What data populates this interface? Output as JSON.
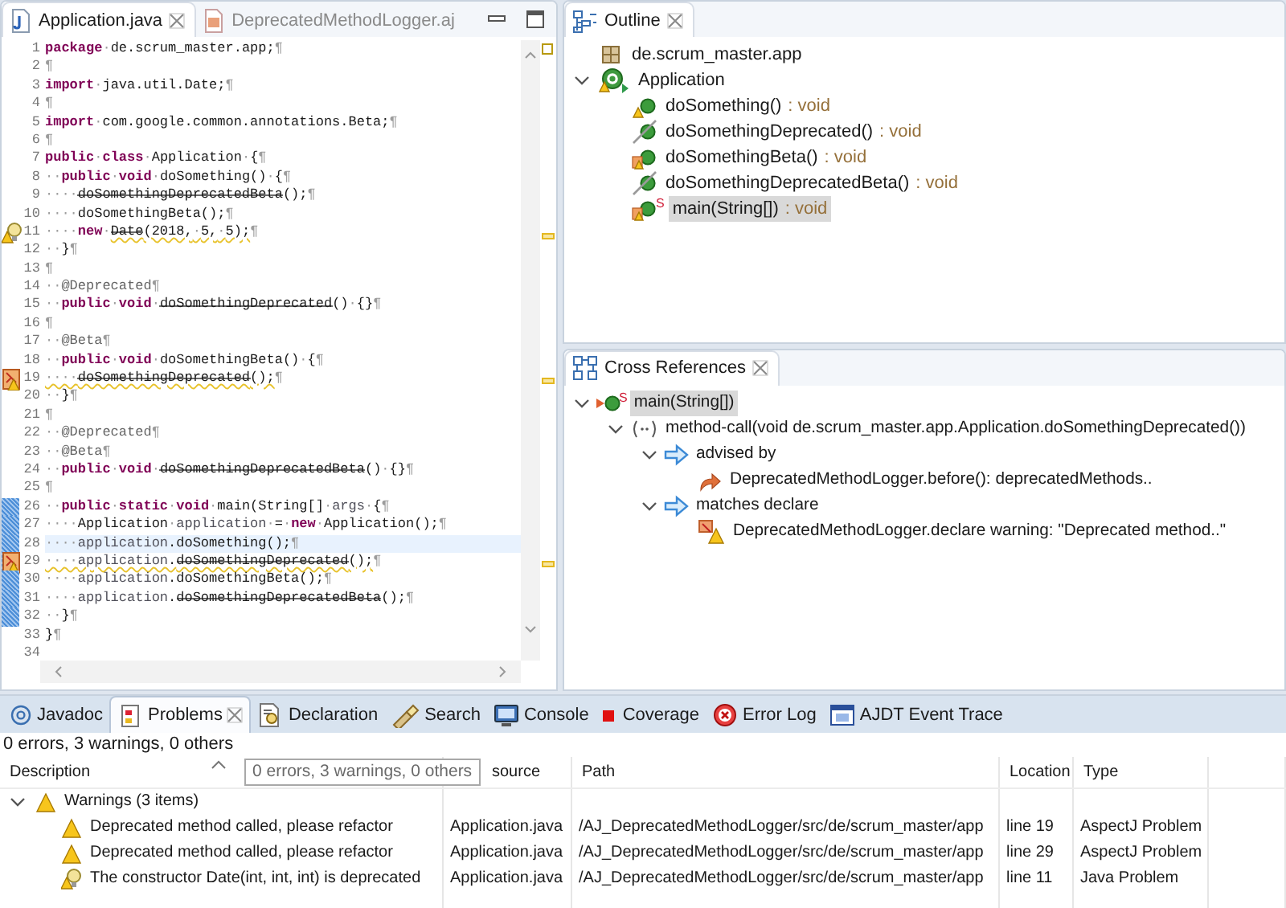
{
  "editor": {
    "tabs": [
      {
        "label": "Application.java",
        "kind": "java",
        "selected": true
      },
      {
        "label": "DeprecatedMethodLogger.aj",
        "kind": "aspect",
        "selected": false
      }
    ],
    "lines": [
      {
        "number": "1",
        "changed": false,
        "current": false,
        "tokens": [
          {
            "kind": "keyword",
            "text": "package"
          },
          {
            "kind": "plain",
            "text": "·de.scrum_master.app;¶"
          }
        ]
      },
      {
        "number": "2",
        "changed": false,
        "current": false,
        "tokens": [
          {
            "kind": "plain",
            "text": "¶"
          }
        ]
      },
      {
        "number": "3",
        "changed": false,
        "current": false,
        "tokens": [
          {
            "kind": "keyword",
            "text": "import"
          },
          {
            "kind": "plain",
            "text": "·java.util.Date;¶"
          }
        ]
      },
      {
        "number": "4",
        "changed": false,
        "current": false,
        "tokens": [
          {
            "kind": "plain",
            "text": "¶"
          }
        ]
      },
      {
        "number": "5",
        "changed": false,
        "current": false,
        "tokens": [
          {
            "kind": "keyword",
            "text": "import"
          },
          {
            "kind": "plain",
            "text": "·com.google.common.annotations.Beta;¶"
          }
        ]
      },
      {
        "number": "6",
        "changed": false,
        "current": false,
        "tokens": [
          {
            "kind": "plain",
            "text": "¶"
          }
        ]
      },
      {
        "number": "7",
        "changed": false,
        "current": false,
        "tokens": [
          {
            "kind": "keyword",
            "text": "public"
          },
          {
            "kind": "plain",
            "text": "·"
          },
          {
            "kind": "keyword",
            "text": "class"
          },
          {
            "kind": "plain",
            "text": "·Application·{¶"
          }
        ]
      },
      {
        "number": "8",
        "changed": false,
        "current": false,
        "tokens": [
          {
            "kind": "plain",
            "text": "··"
          },
          {
            "kind": "keyword",
            "text": "public"
          },
          {
            "kind": "plain",
            "text": "·"
          },
          {
            "kind": "keyword",
            "text": "void"
          },
          {
            "kind": "plain",
            "text": "·doSomething()·{¶"
          }
        ]
      },
      {
        "number": "9",
        "changed": false,
        "current": false,
        "tokens": [
          {
            "kind": "plain",
            "text": "····"
          },
          {
            "kind": "deprecated",
            "text": "doSomethingDeprecatedBeta"
          },
          {
            "kind": "plain",
            "text": "();¶"
          }
        ]
      },
      {
        "number": "10",
        "changed": false,
        "current": false,
        "tokens": [
          {
            "kind": "plain",
            "text": "····doSomethingBeta();¶"
          }
        ]
      },
      {
        "number": "11",
        "changed": false,
        "current": false,
        "kind": "lightbulb-warning",
        "tokens": [
          {
            "kind": "plain",
            "text": "····"
          },
          {
            "kind": "keyword",
            "text": "new"
          },
          {
            "kind": "plain",
            "text": "·"
          },
          {
            "kind": "deprecated-warn",
            "text": "Date"
          },
          {
            "kind": "plain-warn",
            "text": "(2018,·5,·5);"
          },
          {
            "kind": "plain",
            "text": "¶"
          }
        ]
      },
      {
        "number": "12",
        "changed": false,
        "current": false,
        "tokens": [
          {
            "kind": "plain",
            "text": "··}¶"
          }
        ]
      },
      {
        "number": "13",
        "changed": false,
        "current": false,
        "tokens": [
          {
            "kind": "plain",
            "text": "¶"
          }
        ]
      },
      {
        "number": "14",
        "changed": false,
        "current": false,
        "tokens": [
          {
            "kind": "plain",
            "text": "··"
          },
          {
            "kind": "annotation",
            "text": "@Deprecated"
          },
          {
            "kind": "plain",
            "text": "¶"
          }
        ]
      },
      {
        "number": "15",
        "changed": false,
        "current": false,
        "tokens": [
          {
            "kind": "plain",
            "text": "··"
          },
          {
            "kind": "keyword",
            "text": "public"
          },
          {
            "kind": "plain",
            "text": "·"
          },
          {
            "kind": "keyword",
            "text": "void"
          },
          {
            "kind": "plain",
            "text": "·"
          },
          {
            "kind": "deprecated",
            "text": "doSomethingDeprecated"
          },
          {
            "kind": "plain",
            "text": "()·{}¶"
          }
        ]
      },
      {
        "number": "16",
        "changed": false,
        "current": false,
        "tokens": [
          {
            "kind": "plain",
            "text": "¶"
          }
        ]
      },
      {
        "number": "17",
        "changed": false,
        "current": false,
        "tokens": [
          {
            "kind": "plain",
            "text": "··"
          },
          {
            "kind": "annotation",
            "text": "@Beta"
          },
          {
            "kind": "plain",
            "text": "¶"
          }
        ]
      },
      {
        "number": "18",
        "changed": false,
        "current": false,
        "tokens": [
          {
            "kind": "plain",
            "text": "··"
          },
          {
            "kind": "keyword",
            "text": "public"
          },
          {
            "kind": "plain",
            "text": "·"
          },
          {
            "kind": "keyword",
            "text": "void"
          },
          {
            "kind": "plain",
            "text": "·doSomethingBeta()·{¶"
          }
        ]
      },
      {
        "number": "19",
        "changed": false,
        "current": false,
        "kind": "aspect-warning",
        "tokens": [
          {
            "kind": "plain-warn",
            "text": "····"
          },
          {
            "kind": "deprecated-warn",
            "text": "doSomethingDeprecated"
          },
          {
            "kind": "plain-warn",
            "text": "();"
          },
          {
            "kind": "plain",
            "text": "¶"
          }
        ]
      },
      {
        "number": "20",
        "changed": false,
        "current": false,
        "tokens": [
          {
            "kind": "plain",
            "text": "··}¶"
          }
        ]
      },
      {
        "number": "21",
        "changed": false,
        "current": false,
        "tokens": [
          {
            "kind": "plain",
            "text": "¶"
          }
        ]
      },
      {
        "number": "22",
        "changed": false,
        "current": false,
        "tokens": [
          {
            "kind": "plain",
            "text": "··"
          },
          {
            "kind": "annotation",
            "text": "@Deprecated"
          },
          {
            "kind": "plain",
            "text": "¶"
          }
        ]
      },
      {
        "number": "23",
        "changed": false,
        "current": false,
        "tokens": [
          {
            "kind": "plain",
            "text": "··"
          },
          {
            "kind": "annotation",
            "text": "@Beta"
          },
          {
            "kind": "plain",
            "text": "¶"
          }
        ]
      },
      {
        "number": "24",
        "changed": false,
        "current": false,
        "tokens": [
          {
            "kind": "plain",
            "text": "··"
          },
          {
            "kind": "keyword",
            "text": "public"
          },
          {
            "kind": "plain",
            "text": "·"
          },
          {
            "kind": "keyword",
            "text": "void"
          },
          {
            "kind": "plain",
            "text": "·"
          },
          {
            "kind": "deprecated",
            "text": "doSomethingDeprecatedBeta"
          },
          {
            "kind": "plain",
            "text": "()·{}¶"
          }
        ]
      },
      {
        "number": "25",
        "changed": false,
        "current": false,
        "tokens": [
          {
            "kind": "plain",
            "text": "¶"
          }
        ]
      },
      {
        "number": "26",
        "changed": true,
        "current": false,
        "tokens": [
          {
            "kind": "plain",
            "text": "··"
          },
          {
            "kind": "keyword",
            "text": "public"
          },
          {
            "kind": "plain",
            "text": "·"
          },
          {
            "kind": "keyword",
            "text": "static"
          },
          {
            "kind": "plain",
            "text": "·"
          },
          {
            "kind": "keyword",
            "text": "void"
          },
          {
            "kind": "plain",
            "text": "·main(String[]·"
          },
          {
            "kind": "variable",
            "text": "args"
          },
          {
            "kind": "plain",
            "text": "·{¶"
          }
        ]
      },
      {
        "number": "27",
        "changed": true,
        "current": false,
        "tokens": [
          {
            "kind": "plain",
            "text": "····Application·"
          },
          {
            "kind": "variable",
            "text": "application"
          },
          {
            "kind": "plain",
            "text": "·=·"
          },
          {
            "kind": "keyword",
            "text": "new"
          },
          {
            "kind": "plain",
            "text": "·Application();¶"
          }
        ]
      },
      {
        "number": "28",
        "changed": true,
        "current": true,
        "tokens": [
          {
            "kind": "plain",
            "text": "····"
          },
          {
            "kind": "variable",
            "text": "application"
          },
          {
            "kind": "plain",
            "text": ".doSomething();¶"
          }
        ]
      },
      {
        "number": "29",
        "changed": true,
        "current": false,
        "kind": "aspect-warning",
        "tokens": [
          {
            "kind": "plain-warn",
            "text": "····"
          },
          {
            "kind": "variable-warn",
            "text": "application"
          },
          {
            "kind": "plain-warn",
            "text": "."
          },
          {
            "kind": "deprecated-warn",
            "text": "doSomethingDeprecated"
          },
          {
            "kind": "plain-warn",
            "text": "();"
          },
          {
            "kind": "plain",
            "text": "¶"
          }
        ]
      },
      {
        "number": "30",
        "changed": true,
        "current": false,
        "tokens": [
          {
            "kind": "plain",
            "text": "····"
          },
          {
            "kind": "variable",
            "text": "application"
          },
          {
            "kind": "plain",
            "text": ".doSomethingBeta();¶"
          }
        ]
      },
      {
        "number": "31",
        "changed": true,
        "current": false,
        "tokens": [
          {
            "kind": "plain",
            "text": "····"
          },
          {
            "kind": "variable",
            "text": "application"
          },
          {
            "kind": "plain",
            "text": "."
          },
          {
            "kind": "deprecated",
            "text": "doSomethingDeprecatedBeta"
          },
          {
            "kind": "plain",
            "text": "();¶"
          }
        ]
      },
      {
        "number": "32",
        "changed": true,
        "current": false,
        "tokens": [
          {
            "kind": "plain",
            "text": "··}¶"
          }
        ]
      },
      {
        "number": "33",
        "changed": false,
        "current": false,
        "tokens": [
          {
            "kind": "plain",
            "text": "}¶"
          }
        ]
      },
      {
        "number": "34",
        "changed": false,
        "current": false
      }
    ]
  },
  "outline": {
    "title": "Outline",
    "items": [
      {
        "kind": "package",
        "label": "de.scrum_master.app",
        "selected": false
      },
      {
        "kind": "class",
        "label": "Application",
        "selected": false,
        "expanded": true,
        "children": [
          {
            "kind": "method-warning",
            "label": "doSomething()",
            "type": ": void",
            "selected": false
          },
          {
            "kind": "method-deprecated",
            "label": "doSomethingDeprecated()",
            "type": ": void",
            "selected": false
          },
          {
            "kind": "method-aspect",
            "label": "doSomethingBeta()",
            "type": ": void",
            "selected": false
          },
          {
            "kind": "method-deprecated",
            "label": "doSomethingDeprecatedBeta()",
            "type": ": void",
            "selected": false
          },
          {
            "kind": "method-aspect",
            "static_mark": "S",
            "label": "main(String[])",
            "type": ": void",
            "selected": true
          }
        ]
      }
    ]
  },
  "cross_references": {
    "title": "Cross References",
    "items": [
      {
        "kind": "method-advised",
        "static_mark": "S",
        "label": "main(String[])",
        "selected": true,
        "expanded": true,
        "children": [
          {
            "kind": "call",
            "label": "method-call(void de.scrum_master.app.Application.doSomethingDeprecated())",
            "selected": false,
            "expanded": true,
            "children": [
              {
                "kind": "relation",
                "label": "advised by",
                "selected": false,
                "expanded": true,
                "children": [
                  {
                    "kind": "advice",
                    "label": "DeprecatedMethodLogger.before(): deprecatedMethods..",
                    "selected": false
                  }
                ]
              },
              {
                "kind": "relation",
                "label": "matches declare",
                "selected": false,
                "expanded": true,
                "children": [
                  {
                    "kind": "declare-warning",
                    "label": "DeprecatedMethodLogger.declare warning: \"Deprecated method..\"",
                    "selected": false
                  }
                ]
              }
            ]
          }
        ]
      }
    ]
  },
  "bottom": {
    "tabs": [
      {
        "label": "Javadoc",
        "kind": "javadoc",
        "selected": false
      },
      {
        "label": "Problems",
        "kind": "problems",
        "selected": true
      },
      {
        "label": "Declaration",
        "kind": "declaration",
        "selected": false
      },
      {
        "label": "Search",
        "kind": "search",
        "selected": false
      },
      {
        "label": "Console",
        "kind": "console",
        "selected": false
      },
      {
        "label": "Coverage",
        "kind": "coverage",
        "selected": false
      },
      {
        "label": "Error Log",
        "kind": "errorlog",
        "selected": false
      },
      {
        "label": "AJDT Event Trace",
        "kind": "ajdt",
        "selected": false
      }
    ],
    "summary": "0 errors, 3 warnings, 0 others",
    "tooltip": "0 errors, 3 warnings, 0 others",
    "columns": [
      "Description",
      "source",
      "Path",
      "Location",
      "Type"
    ],
    "groups": [
      {
        "label": "Warnings (3 items)",
        "expanded": true,
        "rows": [
          {
            "kind": "warning",
            "description": "Deprecated method called, please refactor",
            "resource": "Application.java",
            "path": "/AJ_DeprecatedMethodLogger/src/de/scrum_master/app",
            "location": "line 19",
            "type": "AspectJ Problem"
          },
          {
            "kind": "warning",
            "description": "Deprecated method called, please refactor",
            "resource": "Application.java",
            "path": "/AJ_DeprecatedMethodLogger/src/de/scrum_master/app",
            "location": "line 29",
            "type": "AspectJ Problem"
          },
          {
            "kind": "lightbulb-warning",
            "description": "The constructor Date(int, int, int) is deprecated",
            "resource": "Application.java",
            "path": "/AJ_DeprecatedMethodLogger/src/de/scrum_master/app",
            "location": "line 11",
            "type": "Java Problem"
          }
        ]
      }
    ]
  }
}
